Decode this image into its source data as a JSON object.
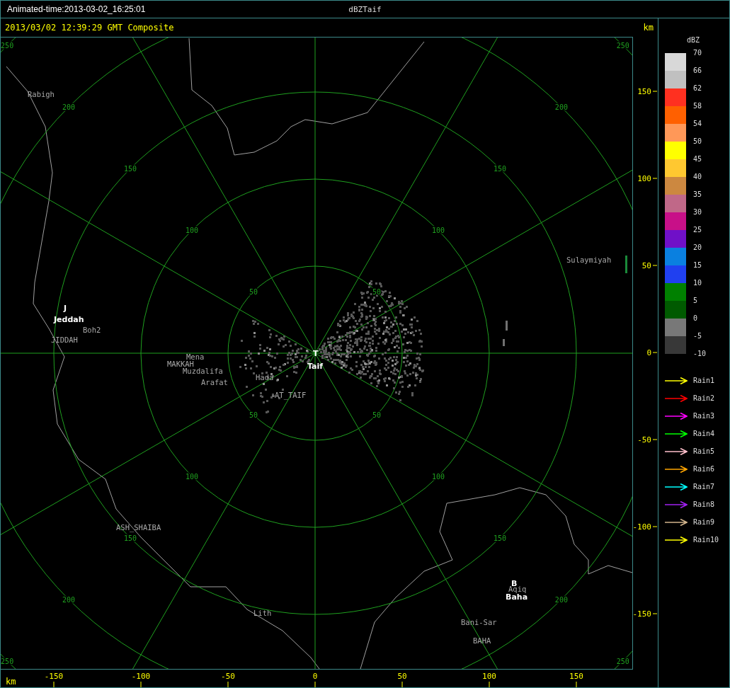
{
  "title_bar": {
    "animated_time": "Animated-time:2013-03-02_16:25:01",
    "title": "dBZTaif"
  },
  "header": {
    "timestamp": "2013/03/02 12:39:29 GMT Composite",
    "unit": "km"
  },
  "map": {
    "places": [
      {
        "name": "Rabigh",
        "kind": "place"
      },
      {
        "name": "J",
        "kind": "station"
      },
      {
        "name": "Jeddah",
        "kind": "station"
      },
      {
        "name": "Boh2",
        "kind": "place"
      },
      {
        "name": "JIDDAH",
        "kind": "place"
      },
      {
        "name": "MAKKAH",
        "kind": "place"
      },
      {
        "name": "Mena",
        "kind": "place"
      },
      {
        "name": "Muzdalifa",
        "kind": "place"
      },
      {
        "name": "Arafat",
        "kind": "place"
      },
      {
        "name": "Hada",
        "kind": "place"
      },
      {
        "name": "T",
        "kind": "station"
      },
      {
        "name": "Taif",
        "kind": "station"
      },
      {
        "name": "AT_TAIF",
        "kind": "place"
      },
      {
        "name": "Sulaymiyah",
        "kind": "place"
      },
      {
        "name": "ASH_SHAIBA",
        "kind": "place"
      },
      {
        "name": "Lith",
        "kind": "place"
      },
      {
        "name": "B",
        "kind": "station"
      },
      {
        "name": "Aqiq",
        "kind": "place"
      },
      {
        "name": "Baha",
        "kind": "station"
      },
      {
        "name": "Bani-Sar",
        "kind": "place"
      },
      {
        "name": "BAHA",
        "kind": "place"
      }
    ],
    "range_rings": [
      {
        "labels": [
          "50",
          "50",
          "50",
          "50"
        ]
      },
      {
        "labels": [
          "100",
          "100",
          "100",
          "100"
        ]
      },
      {
        "labels": [
          "150",
          "150",
          "150",
          "150"
        ]
      },
      {
        "labels": [
          "200",
          "200",
          "200",
          "200"
        ]
      },
      {
        "labels": [
          "250",
          "250",
          "250",
          "250"
        ]
      }
    ]
  },
  "y_axis": {
    "ticks": [
      "150",
      "100",
      "50",
      "0",
      "-50",
      "-100",
      "-150"
    ]
  },
  "x_axis": {
    "unit": "km",
    "ticks": [
      "-150",
      "-100",
      "-50",
      "0",
      "50",
      "100",
      "150"
    ]
  },
  "legend": {
    "title": "dBZ",
    "bins": [
      {
        "color": "#d8d8d8"
      },
      {
        "color": "#c0c0c0"
      },
      {
        "color": "#ff3020"
      },
      {
        "color": "#ff6000"
      },
      {
        "color": "#ff9858"
      },
      {
        "color": "#ffff00"
      },
      {
        "color": "#ffc830"
      },
      {
        "color": "#cc8840"
      },
      {
        "color": "#c06888"
      },
      {
        "color": "#c81088"
      },
      {
        "color": "#7010c8"
      },
      {
        "color": "#0a80e0"
      },
      {
        "color": "#2040f0"
      },
      {
        "color": "#008000"
      },
      {
        "color": "#005a00"
      },
      {
        "color": "#787878"
      },
      {
        "color": "#383838"
      }
    ],
    "labels": [
      "70",
      "66",
      "62",
      "58",
      "54",
      "50",
      "45",
      "40",
      "35",
      "30",
      "25",
      "20",
      "15",
      "10",
      "5",
      "0",
      "-5",
      "-10"
    ],
    "tracks": [
      {
        "label": "Rain1",
        "color": "#ffff00"
      },
      {
        "label": "Rain2",
        "color": "#ff0000"
      },
      {
        "label": "Rain3",
        "color": "#ff00ff"
      },
      {
        "label": "Rain4",
        "color": "#00ff00"
      },
      {
        "label": "Rain5",
        "color": "#ffc0cb"
      },
      {
        "label": "Rain6",
        "color": "#ffa500"
      },
      {
        "label": "Rain7",
        "color": "#00ffff"
      },
      {
        "label": "Rain8",
        "color": "#a020f0"
      },
      {
        "label": "Rain9",
        "color": "#d2b48c"
      },
      {
        "label": "Rain10",
        "color": "#ffff00"
      }
    ]
  }
}
